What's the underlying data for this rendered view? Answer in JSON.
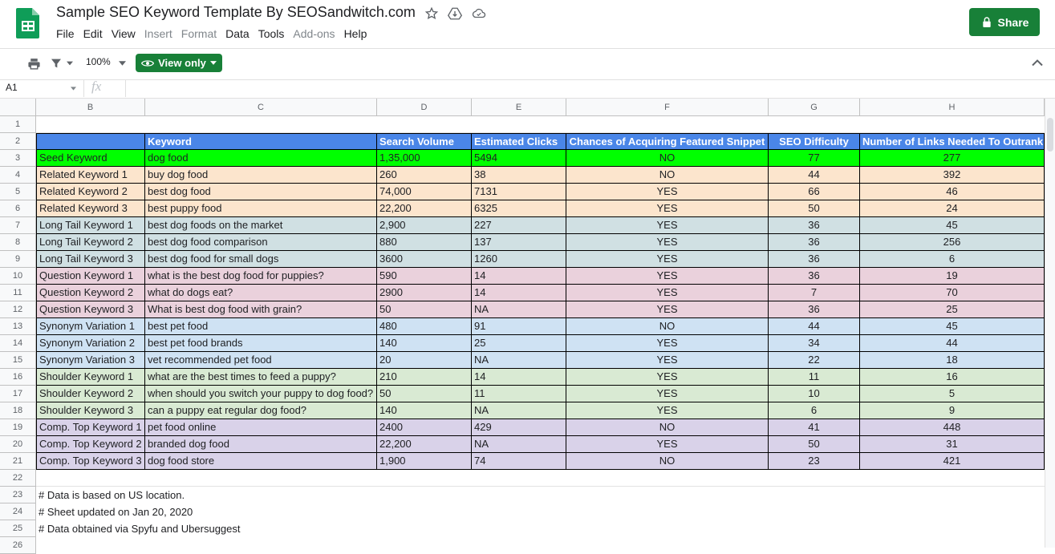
{
  "app": {
    "title": "Sample SEO Keyword Template By SEOSandwitch.com",
    "share_label": "Share",
    "menu": [
      "File",
      "Edit",
      "View",
      "Insert",
      "Format",
      "Data",
      "Tools",
      "Add-ons",
      "Help"
    ],
    "menu_disabled": [
      "Insert",
      "Format",
      "Add-ons"
    ]
  },
  "toolbar": {
    "zoom": "100%",
    "view_only_label": "View only"
  },
  "formula_bar": {
    "cell_ref": "A1",
    "fx": "fx"
  },
  "columns": [
    "B",
    "C",
    "D",
    "E",
    "F",
    "G",
    "H"
  ],
  "rows": [
    "1",
    "2",
    "3",
    "4",
    "5",
    "6",
    "7",
    "8",
    "9",
    "10",
    "11",
    "12",
    "13",
    "14",
    "15",
    "16",
    "17",
    "18",
    "19",
    "20",
    "21",
    "22",
    "23",
    "24",
    "25",
    "26"
  ],
  "colors": {
    "header": "#4a86e8",
    "seed": "#00ff00",
    "related": "#fce5cd",
    "long_tail": "#d0e0e3",
    "question": "#ead1dc",
    "synonym": "#cfe2f3",
    "shoulder": "#d9ead3",
    "comp": "#d9d2e9",
    "accent_green": "#188038"
  },
  "table": {
    "headers": [
      "",
      "Keyword",
      "Search Volume",
      "Estimated Clicks",
      "Chances of Acquiring Featured Snippet",
      "SEO Difficulty",
      "Number of Links Needed To Outrank"
    ],
    "rows": [
      {
        "group": "seed",
        "cells": [
          "Seed Keyword",
          "dog food",
          "1,35,000",
          "5494",
          "NO",
          "77",
          "277"
        ]
      },
      {
        "group": "related",
        "cells": [
          "Related Keyword 1",
          "buy dog food",
          "260",
          "38",
          "NO",
          "44",
          "392"
        ]
      },
      {
        "group": "related",
        "cells": [
          "Related Keyword 2",
          "best dog food",
          "74,000",
          "7131",
          "YES",
          "66",
          "46"
        ]
      },
      {
        "group": "related",
        "cells": [
          "Related Keyword 3",
          "best puppy food",
          "22,200",
          "6325",
          "YES",
          "50",
          "24"
        ]
      },
      {
        "group": "long_tail",
        "cells": [
          "Long Tail Keyword 1",
          "best dog foods on the market",
          "2,900",
          "227",
          "YES",
          "36",
          "45"
        ]
      },
      {
        "group": "long_tail",
        "cells": [
          "Long Tail Keyword 2",
          "best dog food comparison",
          "880",
          "137",
          "YES",
          "36",
          "256"
        ]
      },
      {
        "group": "long_tail",
        "cells": [
          "Long Tail Keyword 3",
          "best dog food for small dogs",
          "3600",
          "1260",
          "YES",
          "36",
          "6"
        ]
      },
      {
        "group": "question",
        "cells": [
          "Question Keyword 1",
          "what is the best dog food for puppies?",
          "590",
          "14",
          "YES",
          "36",
          "19"
        ]
      },
      {
        "group": "question",
        "cells": [
          "Question Keyword 2",
          "what do dogs eat?",
          "2900",
          "14",
          "YES",
          "7",
          "70"
        ]
      },
      {
        "group": "question",
        "cells": [
          "Question Keyword 3",
          "What is best dog food with grain?",
          "50",
          "NA",
          "YES",
          "36",
          "25"
        ]
      },
      {
        "group": "synonym",
        "cells": [
          "Synonym Variation 1",
          "best pet food",
          "480",
          "91",
          "NO",
          "44",
          "45"
        ]
      },
      {
        "group": "synonym",
        "cells": [
          "Synonym Variation 2",
          "best pet food brands",
          "140",
          "25",
          "YES",
          "34",
          "44"
        ]
      },
      {
        "group": "synonym",
        "cells": [
          "Synonym Variation 3",
          "vet recommended pet food",
          "20",
          "NA",
          "YES",
          "22",
          "18"
        ]
      },
      {
        "group": "shoulder",
        "cells": [
          "Shoulder Keyword 1",
          "what are the best times to feed a puppy?",
          "210",
          "14",
          "YES",
          "11",
          "16"
        ]
      },
      {
        "group": "shoulder",
        "cells": [
          "Shoulder Keyword 2",
          "when should you switch your puppy to dog food?",
          "50",
          "11",
          "YES",
          "10",
          "5"
        ]
      },
      {
        "group": "shoulder",
        "cells": [
          "Shoulder Keyword 3",
          "can a puppy eat regular dog food?",
          "140",
          "NA",
          "YES",
          "6",
          "9"
        ]
      },
      {
        "group": "comp",
        "cells": [
          "Comp. Top Keyword 1",
          "pet food online",
          "2400",
          "429",
          "NO",
          "41",
          "448"
        ]
      },
      {
        "group": "comp",
        "cells": [
          "Comp. Top Keyword 2",
          "branded dog food",
          "22,200",
          "NA",
          "YES",
          "50",
          "31"
        ]
      },
      {
        "group": "comp",
        "cells": [
          "Comp. Top Keyword 3",
          "dog food store",
          "1,900",
          "74",
          "NO",
          "23",
          "421"
        ]
      }
    ]
  },
  "notes": [
    "# Data is based on US location.",
    "# Sheet updated on Jan 20, 2020",
    "# Data obtained via Spyfu and Ubersuggest"
  ]
}
